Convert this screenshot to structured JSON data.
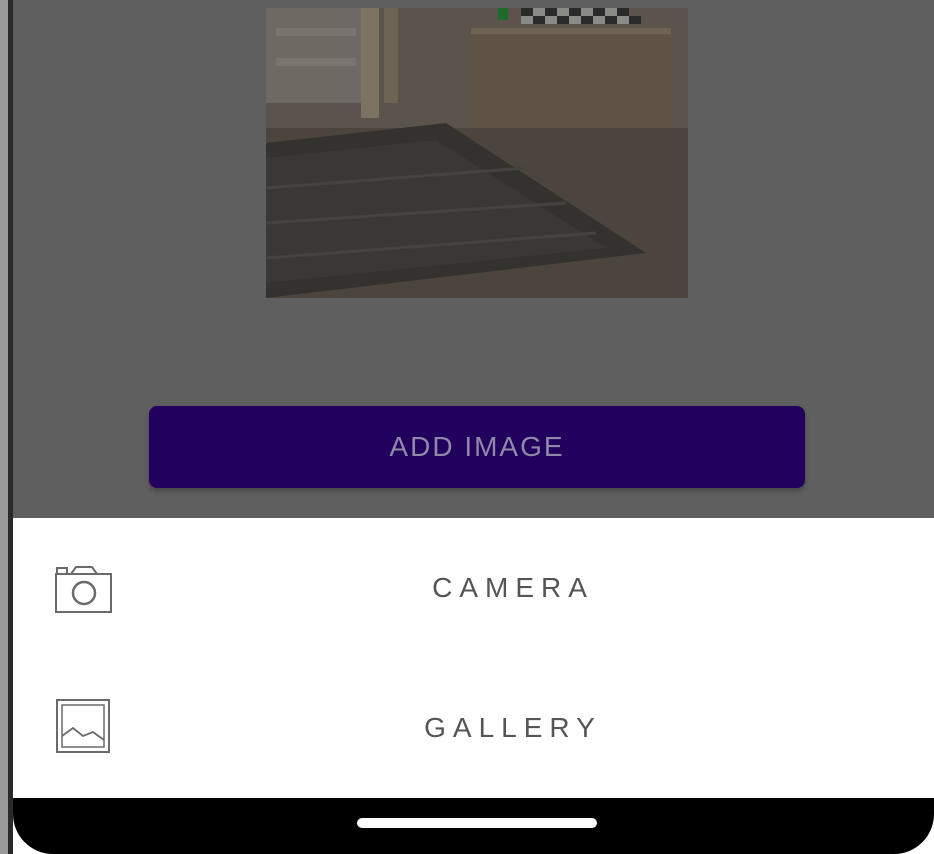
{
  "main": {
    "add_image_label": "ADD IMAGE"
  },
  "sheet": {
    "items": [
      {
        "label": "CAMERA",
        "icon": "camera-icon"
      },
      {
        "label": "GALLERY",
        "icon": "gallery-icon"
      }
    ]
  },
  "colors": {
    "primary_button": "#22005e",
    "scrim": "#5f5f5f",
    "sheet_background": "#ffffff",
    "nav_bar": "#000000"
  }
}
